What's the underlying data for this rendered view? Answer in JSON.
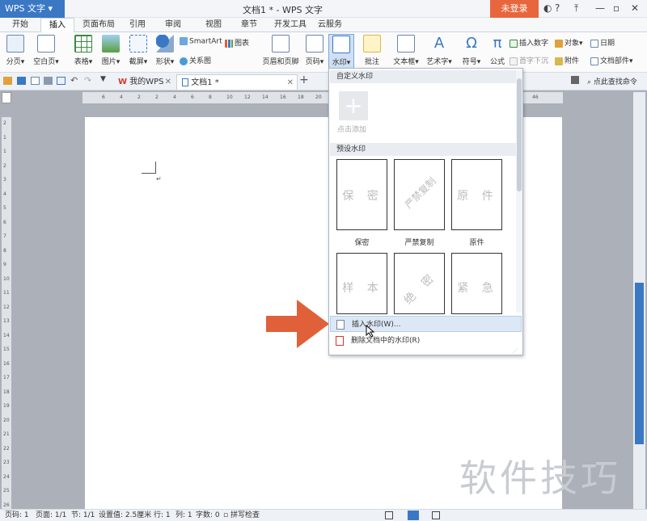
{
  "titlebar": {
    "app_label": "WPS 文字",
    "window_title": "文档1 * - WPS 文字",
    "login_label": "未登录"
  },
  "tabs": [
    "开始",
    "插入",
    "页面布局",
    "引用",
    "审阅",
    "视图",
    "章节",
    "开发工具",
    "云服务"
  ],
  "ribbon": {
    "page_break": "分页",
    "blank_page": "空白页",
    "table": "表格",
    "picture": "图片",
    "screenshot": "截屏",
    "shapes": "形状",
    "smartart": "SmartArt",
    "chart": "图表",
    "relation": "关系图",
    "header_footer": "页眉和页脚",
    "page_number": "页码",
    "watermark": "水印",
    "comment": "批注",
    "textbox": "文本框",
    "wordart": "艺术字",
    "symbol": "符号",
    "formula": "公式",
    "insert_number": "插入数字",
    "object": "对象",
    "date": "日期",
    "dropcap": "首字下沉",
    "attachment": "附件",
    "doc_parts": "文档部件"
  },
  "doc_tabs": {
    "home": "我的WPS",
    "doc": "文档1 *",
    "command_search": "点此查找命令"
  },
  "ruler": {
    "h_marks": [
      "6",
      "4",
      "2",
      "2",
      "4",
      "6",
      "8",
      "10",
      "12",
      "14",
      "16",
      "18",
      "20",
      "44",
      "46"
    ],
    "v_marks": [
      "2",
      "1",
      "1",
      "2",
      "3",
      "4",
      "5",
      "6",
      "7",
      "8",
      "9",
      "10",
      "11",
      "12",
      "13",
      "14",
      "15",
      "16",
      "17",
      "18",
      "19",
      "20",
      "21",
      "22",
      "23",
      "24",
      "25",
      "26"
    ]
  },
  "watermark_menu": {
    "custom_header": "自定义水印",
    "add_label": "点击添加",
    "preset_header": "预设水印",
    "presets": [
      {
        "text": "保 密",
        "label": "保密"
      },
      {
        "text": "严禁复制",
        "label": "严禁复制"
      },
      {
        "text": "原 件",
        "label": "原件"
      },
      {
        "text": "样 本",
        "label": ""
      },
      {
        "text": "绝 密",
        "label": ""
      },
      {
        "text": "紧 急",
        "label": ""
      }
    ],
    "insert_label": "插入水印(W)...",
    "delete_label": "删除文档中的水印(R)"
  },
  "statusbar": {
    "page_num": "页码: 1",
    "pages": "页面: 1/1",
    "section": "节: 1/1",
    "setting": "设置值: 2.5厘米",
    "row": "行: 1",
    "col": "列: 1",
    "words": "字数: 0",
    "spell": "拼写检查"
  },
  "brand_watermark": "软件技巧",
  "colors": {
    "accent_blue": "#3b78c4",
    "login_orange": "#e8663d",
    "arrow_orange": "#e0603a",
    "workspace_gray": "#abb0b9"
  }
}
